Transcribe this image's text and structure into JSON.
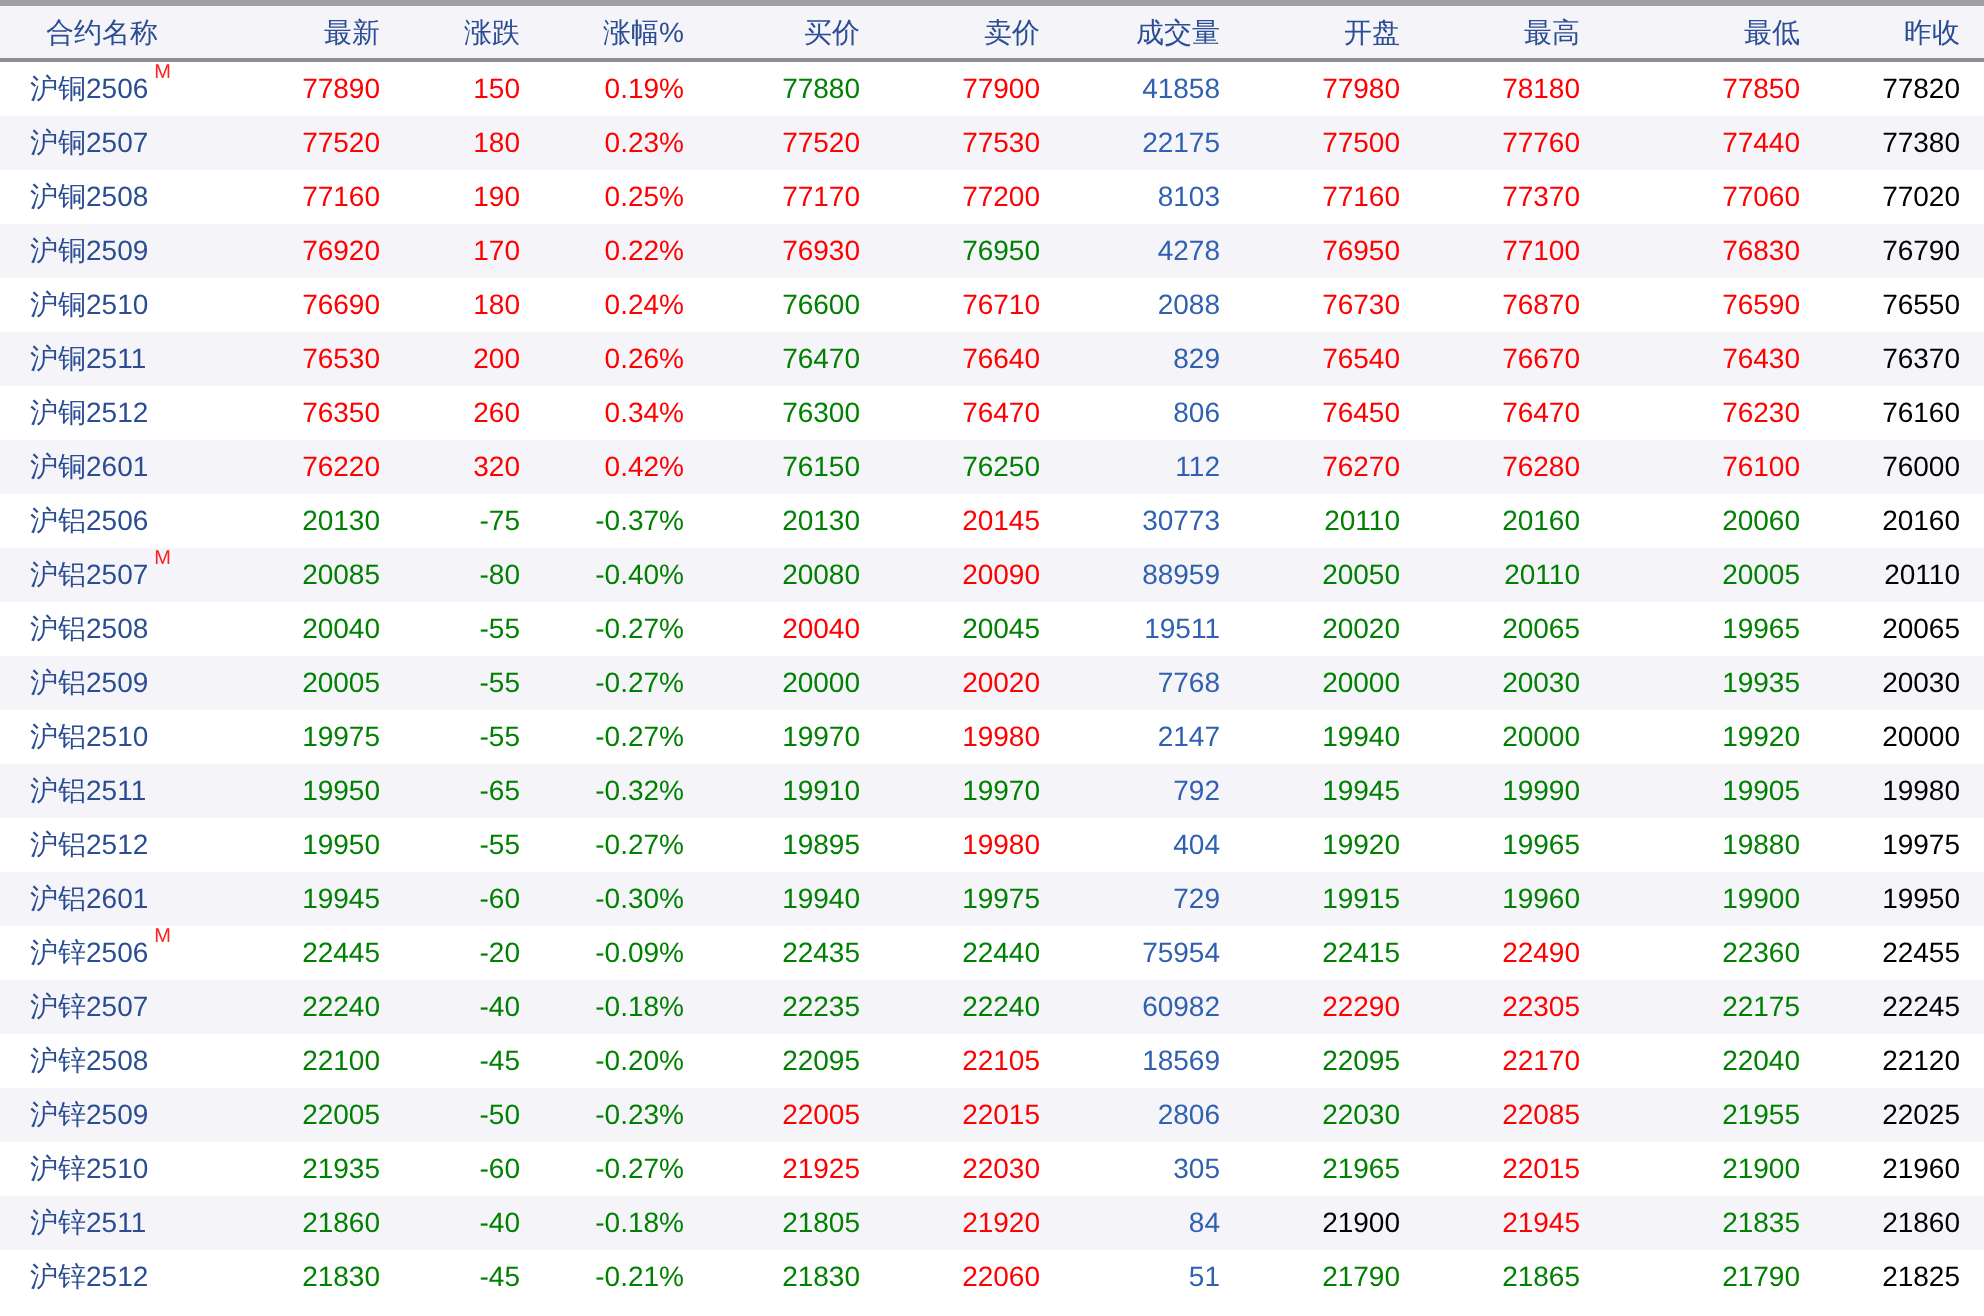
{
  "table": {
    "columns": [
      "合约名称",
      "最新",
      "涨跌",
      "涨幅%",
      "买价",
      "卖价",
      "成交量",
      "开盘",
      "最高",
      "最低",
      "昨收"
    ],
    "rows": [
      {
        "cells": [
          {
            "text": "沪铜2506",
            "marker": "M"
          },
          {
            "text": "77890",
            "color": "#ff0000"
          },
          {
            "text": "150",
            "color": "#ff0000"
          },
          {
            "text": "0.19%",
            "color": "#ff0000"
          },
          {
            "text": "77880",
            "color": "#008000"
          },
          {
            "text": "77900",
            "color": "#ff0000"
          },
          {
            "text": "41858",
            "color": "#3060b0"
          },
          {
            "text": "77980",
            "color": "#ff0000"
          },
          {
            "text": "78180",
            "color": "#ff0000"
          },
          {
            "text": "77850",
            "color": "#ff0000"
          },
          {
            "text": "77820",
            "color": "#000000"
          }
        ]
      },
      {
        "cells": [
          {
            "text": "沪铜2507"
          },
          {
            "text": "77520",
            "color": "#ff0000"
          },
          {
            "text": "180",
            "color": "#ff0000"
          },
          {
            "text": "0.23%",
            "color": "#ff0000"
          },
          {
            "text": "77520",
            "color": "#ff0000"
          },
          {
            "text": "77530",
            "color": "#ff0000"
          },
          {
            "text": "22175",
            "color": "#3060b0"
          },
          {
            "text": "77500",
            "color": "#ff0000"
          },
          {
            "text": "77760",
            "color": "#ff0000"
          },
          {
            "text": "77440",
            "color": "#ff0000"
          },
          {
            "text": "77380",
            "color": "#000000"
          }
        ]
      },
      {
        "cells": [
          {
            "text": "沪铜2508"
          },
          {
            "text": "77160",
            "color": "#ff0000"
          },
          {
            "text": "190",
            "color": "#ff0000"
          },
          {
            "text": "0.25%",
            "color": "#ff0000"
          },
          {
            "text": "77170",
            "color": "#ff0000"
          },
          {
            "text": "77200",
            "color": "#ff0000"
          },
          {
            "text": "8103",
            "color": "#3060b0"
          },
          {
            "text": "77160",
            "color": "#ff0000"
          },
          {
            "text": "77370",
            "color": "#ff0000"
          },
          {
            "text": "77060",
            "color": "#ff0000"
          },
          {
            "text": "77020",
            "color": "#000000"
          }
        ]
      },
      {
        "cells": [
          {
            "text": "沪铜2509"
          },
          {
            "text": "76920",
            "color": "#ff0000"
          },
          {
            "text": "170",
            "color": "#ff0000"
          },
          {
            "text": "0.22%",
            "color": "#ff0000"
          },
          {
            "text": "76930",
            "color": "#ff0000"
          },
          {
            "text": "76950",
            "color": "#008000"
          },
          {
            "text": "4278",
            "color": "#3060b0"
          },
          {
            "text": "76950",
            "color": "#ff0000"
          },
          {
            "text": "77100",
            "color": "#ff0000"
          },
          {
            "text": "76830",
            "color": "#ff0000"
          },
          {
            "text": "76790",
            "color": "#000000"
          }
        ]
      },
      {
        "cells": [
          {
            "text": "沪铜2510"
          },
          {
            "text": "76690",
            "color": "#ff0000"
          },
          {
            "text": "180",
            "color": "#ff0000"
          },
          {
            "text": "0.24%",
            "color": "#ff0000"
          },
          {
            "text": "76600",
            "color": "#008000"
          },
          {
            "text": "76710",
            "color": "#ff0000"
          },
          {
            "text": "2088",
            "color": "#3060b0"
          },
          {
            "text": "76730",
            "color": "#ff0000"
          },
          {
            "text": "76870",
            "color": "#ff0000"
          },
          {
            "text": "76590",
            "color": "#ff0000"
          },
          {
            "text": "76550",
            "color": "#000000"
          }
        ]
      },
      {
        "cells": [
          {
            "text": "沪铜2511"
          },
          {
            "text": "76530",
            "color": "#ff0000"
          },
          {
            "text": "200",
            "color": "#ff0000"
          },
          {
            "text": "0.26%",
            "color": "#ff0000"
          },
          {
            "text": "76470",
            "color": "#008000"
          },
          {
            "text": "76640",
            "color": "#ff0000"
          },
          {
            "text": "829",
            "color": "#3060b0"
          },
          {
            "text": "76540",
            "color": "#ff0000"
          },
          {
            "text": "76670",
            "color": "#ff0000"
          },
          {
            "text": "76430",
            "color": "#ff0000"
          },
          {
            "text": "76370",
            "color": "#000000"
          }
        ]
      },
      {
        "cells": [
          {
            "text": "沪铜2512"
          },
          {
            "text": "76350",
            "color": "#ff0000"
          },
          {
            "text": "260",
            "color": "#ff0000"
          },
          {
            "text": "0.34%",
            "color": "#ff0000"
          },
          {
            "text": "76300",
            "color": "#008000"
          },
          {
            "text": "76470",
            "color": "#ff0000"
          },
          {
            "text": "806",
            "color": "#3060b0"
          },
          {
            "text": "76450",
            "color": "#ff0000"
          },
          {
            "text": "76470",
            "color": "#ff0000"
          },
          {
            "text": "76230",
            "color": "#ff0000"
          },
          {
            "text": "76160",
            "color": "#000000"
          }
        ]
      },
      {
        "cells": [
          {
            "text": "沪铜2601"
          },
          {
            "text": "76220",
            "color": "#ff0000"
          },
          {
            "text": "320",
            "color": "#ff0000"
          },
          {
            "text": "0.42%",
            "color": "#ff0000"
          },
          {
            "text": "76150",
            "color": "#008000"
          },
          {
            "text": "76250",
            "color": "#008000"
          },
          {
            "text": "112",
            "color": "#3060b0"
          },
          {
            "text": "76270",
            "color": "#ff0000"
          },
          {
            "text": "76280",
            "color": "#ff0000"
          },
          {
            "text": "76100",
            "color": "#ff0000"
          },
          {
            "text": "76000",
            "color": "#000000"
          }
        ]
      },
      {
        "cells": [
          {
            "text": "沪铝2506"
          },
          {
            "text": "20130",
            "color": "#008000"
          },
          {
            "text": "-75",
            "color": "#008000"
          },
          {
            "text": "-0.37%",
            "color": "#008000"
          },
          {
            "text": "20130",
            "color": "#008000"
          },
          {
            "text": "20145",
            "color": "#ff0000"
          },
          {
            "text": "30773",
            "color": "#3060b0"
          },
          {
            "text": "20110",
            "color": "#008000"
          },
          {
            "text": "20160",
            "color": "#008000"
          },
          {
            "text": "20060",
            "color": "#008000"
          },
          {
            "text": "20160",
            "color": "#000000"
          }
        ]
      },
      {
        "cells": [
          {
            "text": "沪铝2507",
            "marker": "M"
          },
          {
            "text": "20085",
            "color": "#008000"
          },
          {
            "text": "-80",
            "color": "#008000"
          },
          {
            "text": "-0.40%",
            "color": "#008000"
          },
          {
            "text": "20080",
            "color": "#008000"
          },
          {
            "text": "20090",
            "color": "#ff0000"
          },
          {
            "text": "88959",
            "color": "#3060b0"
          },
          {
            "text": "20050",
            "color": "#008000"
          },
          {
            "text": "20110",
            "color": "#008000"
          },
          {
            "text": "20005",
            "color": "#008000"
          },
          {
            "text": "20110",
            "color": "#000000"
          }
        ]
      },
      {
        "cells": [
          {
            "text": "沪铝2508"
          },
          {
            "text": "20040",
            "color": "#008000"
          },
          {
            "text": "-55",
            "color": "#008000"
          },
          {
            "text": "-0.27%",
            "color": "#008000"
          },
          {
            "text": "20040",
            "color": "#ff0000"
          },
          {
            "text": "20045",
            "color": "#008000"
          },
          {
            "text": "19511",
            "color": "#3060b0"
          },
          {
            "text": "20020",
            "color": "#008000"
          },
          {
            "text": "20065",
            "color": "#008000"
          },
          {
            "text": "19965",
            "color": "#008000"
          },
          {
            "text": "20065",
            "color": "#000000"
          }
        ]
      },
      {
        "cells": [
          {
            "text": "沪铝2509"
          },
          {
            "text": "20005",
            "color": "#008000"
          },
          {
            "text": "-55",
            "color": "#008000"
          },
          {
            "text": "-0.27%",
            "color": "#008000"
          },
          {
            "text": "20000",
            "color": "#008000"
          },
          {
            "text": "20020",
            "color": "#ff0000"
          },
          {
            "text": "7768",
            "color": "#3060b0"
          },
          {
            "text": "20000",
            "color": "#008000"
          },
          {
            "text": "20030",
            "color": "#008000"
          },
          {
            "text": "19935",
            "color": "#008000"
          },
          {
            "text": "20030",
            "color": "#000000"
          }
        ]
      },
      {
        "cells": [
          {
            "text": "沪铝2510"
          },
          {
            "text": "19975",
            "color": "#008000"
          },
          {
            "text": "-55",
            "color": "#008000"
          },
          {
            "text": "-0.27%",
            "color": "#008000"
          },
          {
            "text": "19970",
            "color": "#008000"
          },
          {
            "text": "19980",
            "color": "#ff0000"
          },
          {
            "text": "2147",
            "color": "#3060b0"
          },
          {
            "text": "19940",
            "color": "#008000"
          },
          {
            "text": "20000",
            "color": "#008000"
          },
          {
            "text": "19920",
            "color": "#008000"
          },
          {
            "text": "20000",
            "color": "#000000"
          }
        ]
      },
      {
        "cells": [
          {
            "text": "沪铝2511"
          },
          {
            "text": "19950",
            "color": "#008000"
          },
          {
            "text": "-65",
            "color": "#008000"
          },
          {
            "text": "-0.32%",
            "color": "#008000"
          },
          {
            "text": "19910",
            "color": "#008000"
          },
          {
            "text": "19970",
            "color": "#008000"
          },
          {
            "text": "792",
            "color": "#3060b0"
          },
          {
            "text": "19945",
            "color": "#008000"
          },
          {
            "text": "19990",
            "color": "#008000"
          },
          {
            "text": "19905",
            "color": "#008000"
          },
          {
            "text": "19980",
            "color": "#000000"
          }
        ]
      },
      {
        "cells": [
          {
            "text": "沪铝2512"
          },
          {
            "text": "19950",
            "color": "#008000"
          },
          {
            "text": "-55",
            "color": "#008000"
          },
          {
            "text": "-0.27%",
            "color": "#008000"
          },
          {
            "text": "19895",
            "color": "#008000"
          },
          {
            "text": "19980",
            "color": "#ff0000"
          },
          {
            "text": "404",
            "color": "#3060b0"
          },
          {
            "text": "19920",
            "color": "#008000"
          },
          {
            "text": "19965",
            "color": "#008000"
          },
          {
            "text": "19880",
            "color": "#008000"
          },
          {
            "text": "19975",
            "color": "#000000"
          }
        ]
      },
      {
        "cells": [
          {
            "text": "沪铝2601"
          },
          {
            "text": "19945",
            "color": "#008000"
          },
          {
            "text": "-60",
            "color": "#008000"
          },
          {
            "text": "-0.30%",
            "color": "#008000"
          },
          {
            "text": "19940",
            "color": "#008000"
          },
          {
            "text": "19975",
            "color": "#008000"
          },
          {
            "text": "729",
            "color": "#3060b0"
          },
          {
            "text": "19915",
            "color": "#008000"
          },
          {
            "text": "19960",
            "color": "#008000"
          },
          {
            "text": "19900",
            "color": "#008000"
          },
          {
            "text": "19950",
            "color": "#000000"
          }
        ]
      },
      {
        "cells": [
          {
            "text": "沪锌2506",
            "marker": "M"
          },
          {
            "text": "22445",
            "color": "#008000"
          },
          {
            "text": "-20",
            "color": "#008000"
          },
          {
            "text": "-0.09%",
            "color": "#008000"
          },
          {
            "text": "22435",
            "color": "#008000"
          },
          {
            "text": "22440",
            "color": "#008000"
          },
          {
            "text": "75954",
            "color": "#3060b0"
          },
          {
            "text": "22415",
            "color": "#008000"
          },
          {
            "text": "22490",
            "color": "#ff0000"
          },
          {
            "text": "22360",
            "color": "#008000"
          },
          {
            "text": "22455",
            "color": "#000000"
          }
        ]
      },
      {
        "cells": [
          {
            "text": "沪锌2507"
          },
          {
            "text": "22240",
            "color": "#008000"
          },
          {
            "text": "-40",
            "color": "#008000"
          },
          {
            "text": "-0.18%",
            "color": "#008000"
          },
          {
            "text": "22235",
            "color": "#008000"
          },
          {
            "text": "22240",
            "color": "#008000"
          },
          {
            "text": "60982",
            "color": "#3060b0"
          },
          {
            "text": "22290",
            "color": "#ff0000"
          },
          {
            "text": "22305",
            "color": "#ff0000"
          },
          {
            "text": "22175",
            "color": "#008000"
          },
          {
            "text": "22245",
            "color": "#000000"
          }
        ]
      },
      {
        "cells": [
          {
            "text": "沪锌2508"
          },
          {
            "text": "22100",
            "color": "#008000"
          },
          {
            "text": "-45",
            "color": "#008000"
          },
          {
            "text": "-0.20%",
            "color": "#008000"
          },
          {
            "text": "22095",
            "color": "#008000"
          },
          {
            "text": "22105",
            "color": "#ff0000"
          },
          {
            "text": "18569",
            "color": "#3060b0"
          },
          {
            "text": "22095",
            "color": "#008000"
          },
          {
            "text": "22170",
            "color": "#ff0000"
          },
          {
            "text": "22040",
            "color": "#008000"
          },
          {
            "text": "22120",
            "color": "#000000"
          }
        ]
      },
      {
        "cells": [
          {
            "text": "沪锌2509"
          },
          {
            "text": "22005",
            "color": "#008000"
          },
          {
            "text": "-50",
            "color": "#008000"
          },
          {
            "text": "-0.23%",
            "color": "#008000"
          },
          {
            "text": "22005",
            "color": "#ff0000"
          },
          {
            "text": "22015",
            "color": "#ff0000"
          },
          {
            "text": "2806",
            "color": "#3060b0"
          },
          {
            "text": "22030",
            "color": "#008000"
          },
          {
            "text": "22085",
            "color": "#ff0000"
          },
          {
            "text": "21955",
            "color": "#008000"
          },
          {
            "text": "22025",
            "color": "#000000"
          }
        ]
      },
      {
        "cells": [
          {
            "text": "沪锌2510"
          },
          {
            "text": "21935",
            "color": "#008000"
          },
          {
            "text": "-60",
            "color": "#008000"
          },
          {
            "text": "-0.27%",
            "color": "#008000"
          },
          {
            "text": "21925",
            "color": "#ff0000"
          },
          {
            "text": "22030",
            "color": "#ff0000"
          },
          {
            "text": "305",
            "color": "#3060b0"
          },
          {
            "text": "21965",
            "color": "#008000"
          },
          {
            "text": "22015",
            "color": "#ff0000"
          },
          {
            "text": "21900",
            "color": "#008000"
          },
          {
            "text": "21960",
            "color": "#000000"
          }
        ]
      },
      {
        "cells": [
          {
            "text": "沪锌2511"
          },
          {
            "text": "21860",
            "color": "#008000"
          },
          {
            "text": "-40",
            "color": "#008000"
          },
          {
            "text": "-0.18%",
            "color": "#008000"
          },
          {
            "text": "21805",
            "color": "#008000"
          },
          {
            "text": "21920",
            "color": "#ff0000"
          },
          {
            "text": "84",
            "color": "#3060b0"
          },
          {
            "text": "21900",
            "color": "#000000"
          },
          {
            "text": "21945",
            "color": "#ff0000"
          },
          {
            "text": "21835",
            "color": "#008000"
          },
          {
            "text": "21860",
            "color": "#000000"
          }
        ]
      },
      {
        "cells": [
          {
            "text": "沪锌2512"
          },
          {
            "text": "21830",
            "color": "#008000"
          },
          {
            "text": "-45",
            "color": "#008000"
          },
          {
            "text": "-0.21%",
            "color": "#008000"
          },
          {
            "text": "21830",
            "color": "#008000"
          },
          {
            "text": "22060",
            "color": "#ff0000"
          },
          {
            "text": "51",
            "color": "#3060b0"
          },
          {
            "text": "21790",
            "color": "#008000"
          },
          {
            "text": "21865",
            "color": "#008000"
          },
          {
            "text": "21790",
            "color": "#008000"
          },
          {
            "text": "21825",
            "color": "#000000"
          }
        ]
      }
    ]
  }
}
